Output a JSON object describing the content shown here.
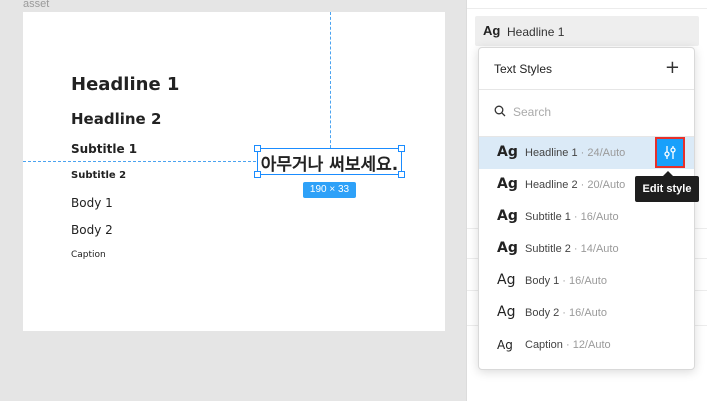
{
  "canvas": {
    "frame_label": "asset",
    "samples": {
      "headline1": "Headline 1",
      "headline2": "Headline 2",
      "subtitle1": "Subtitle 1",
      "subtitle2": "Subtitle 2",
      "body1": "Body 1",
      "body2": "Body 2",
      "caption": "Caption"
    },
    "selected_text": "아무거나 써보세요.",
    "dimensions": "190 × 33"
  },
  "panel": {
    "current_style": {
      "ag": "Ag",
      "name": "Headline 1"
    },
    "popover": {
      "title": "Text Styles",
      "add_glyph": "+",
      "search_placeholder": "Search",
      "items": [
        {
          "ag": "Ag",
          "name": "Headline 1",
          "meta": " · 24/Auto"
        },
        {
          "ag": "Ag",
          "name": "Headline 2",
          "meta": " · 20/Auto"
        },
        {
          "ag": "Ag",
          "name": "Subtitle 1",
          "meta": " · 16/Auto"
        },
        {
          "ag": "Ag",
          "name": "Subtitle 2",
          "meta": " · 14/Auto"
        },
        {
          "ag": "Ag",
          "name": "Body 1",
          "meta": " · 16/Auto"
        },
        {
          "ag": "Ag",
          "name": "Body 2",
          "meta": " · 16/Auto"
        },
        {
          "ag": "Ag",
          "name": "Caption",
          "meta": " · 12/Auto"
        }
      ]
    },
    "edit_tooltip": "Edit style"
  },
  "colors": {
    "selection": "#1a8cff",
    "accent": "#18a0fb",
    "highlight_border": "#e8302a",
    "active_row": "#dbeaf7"
  }
}
